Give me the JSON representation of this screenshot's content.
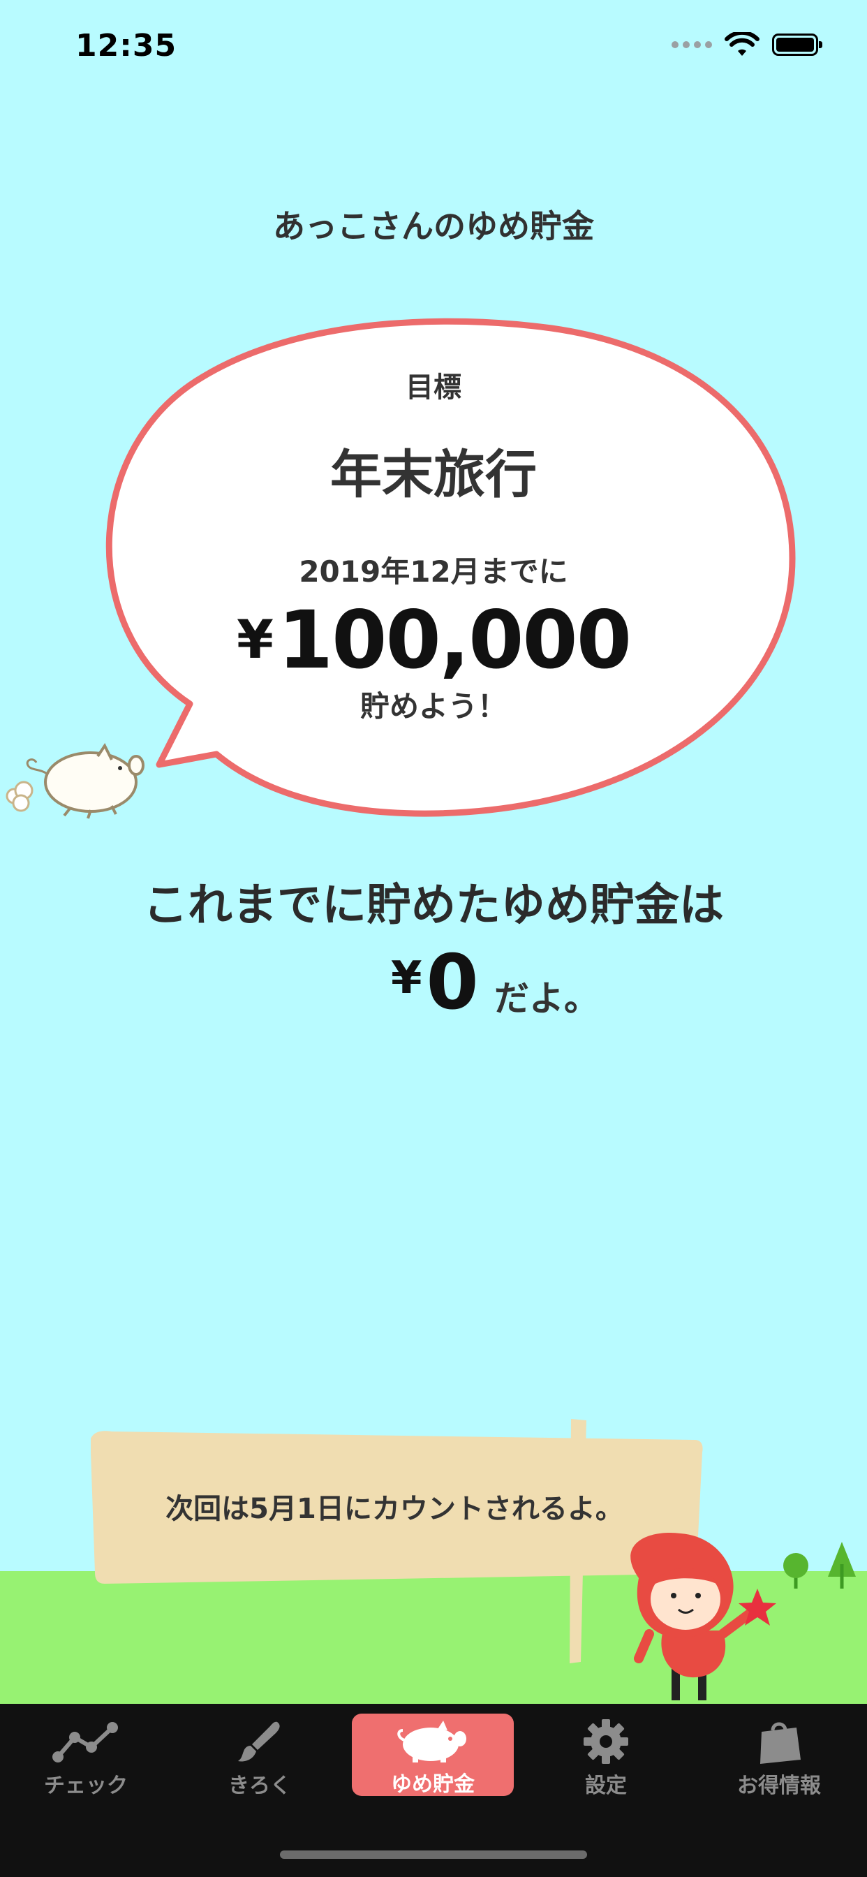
{
  "status_bar": {
    "time": "12:35"
  },
  "page": {
    "title": "あっこさんのゆめ貯金"
  },
  "goal": {
    "label": "目標",
    "name": "年末旅行",
    "deadline": "2019年12月までに",
    "currency": "¥",
    "amount": "100,000",
    "suffix": "貯めよう！"
  },
  "savings": {
    "label": "これまでに貯めたゆめ貯金は",
    "currency": "¥",
    "amount": "0",
    "suffix": "だよ。"
  },
  "sign": {
    "message": "次回は5月1日にカウントされるよ。"
  },
  "tab_bar": {
    "items": [
      {
        "label": "チェック",
        "icon": "chart-line-icon",
        "active": false
      },
      {
        "label": "きろく",
        "icon": "brush-icon",
        "active": false
      },
      {
        "label": "ゆめ貯金",
        "icon": "piggy-icon",
        "active": true
      },
      {
        "label": "設定",
        "icon": "gear-icon",
        "active": false
      },
      {
        "label": "お得情報",
        "icon": "shopping-bag-icon",
        "active": false
      }
    ]
  },
  "colors": {
    "background": "#b8fbff",
    "bubble_border": "#ec6b6b",
    "grass": "#97f272",
    "sign": "#f0ddb1",
    "tab_active": "#ef6f6f",
    "tab_bar": "#111111"
  }
}
